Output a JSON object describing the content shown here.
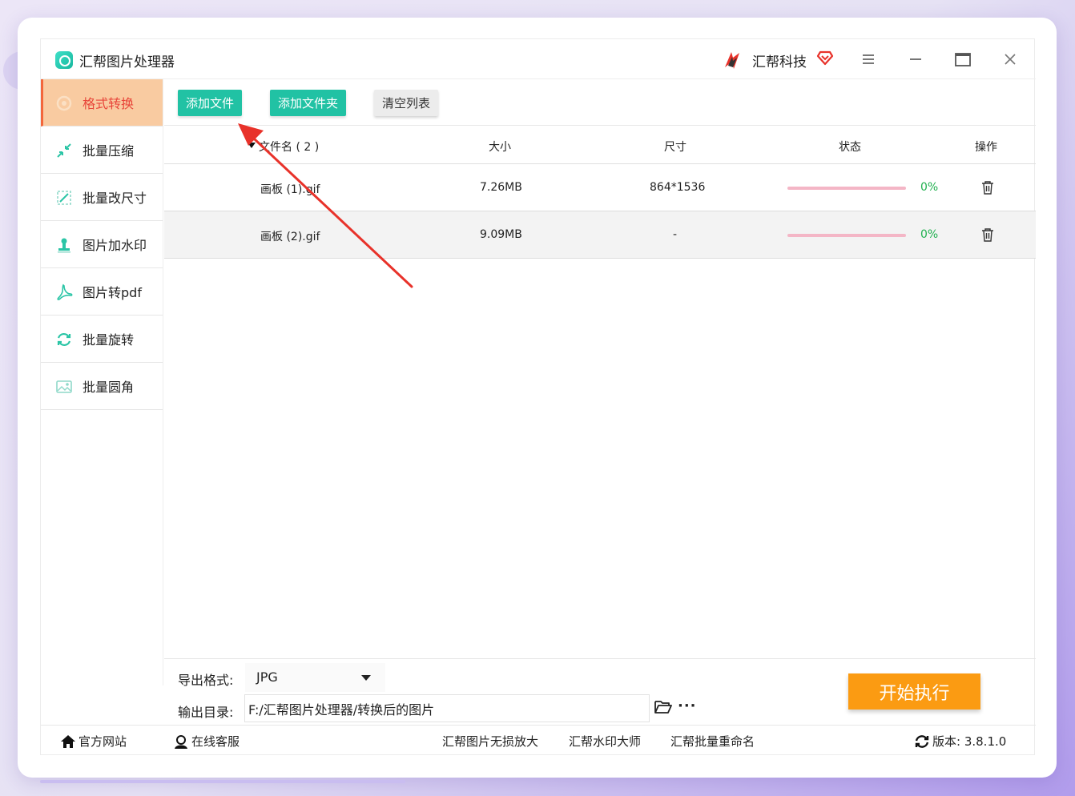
{
  "app": {
    "title": "汇帮图片处理器",
    "brand": "汇帮科技"
  },
  "titlebar_icons": {
    "logo": "app-logo-icon",
    "brand": "flame-logo-icon",
    "vip": "vip-heart-icon",
    "menu": "menu-icon",
    "minimize": "minimize-icon",
    "maximize": "maximize-icon",
    "close": "close-icon"
  },
  "sidebar": {
    "items": [
      {
        "label": "格式转换",
        "icon": "format-convert-icon",
        "active": true
      },
      {
        "label": "批量压缩",
        "icon": "compress-icon",
        "active": false
      },
      {
        "label": "批量改尺寸",
        "icon": "resize-icon",
        "active": false
      },
      {
        "label": "图片加水印",
        "icon": "watermark-icon",
        "active": false
      },
      {
        "label": "图片转pdf",
        "icon": "pdf-icon",
        "active": false
      },
      {
        "label": "批量旋转",
        "icon": "rotate-icon",
        "active": false
      },
      {
        "label": "批量圆角",
        "icon": "rounded-corner-icon",
        "active": false
      }
    ]
  },
  "toolbar": {
    "add_file": "添加文件",
    "add_folder": "添加文件夹",
    "clear_list": "清空列表"
  },
  "table": {
    "headers": {
      "name": "文件名 ( 2 )",
      "size": "大小",
      "dimensions": "尺寸",
      "status": "状态",
      "action": "操作"
    },
    "rows": [
      {
        "name": "画板 (1).gif",
        "size": "7.26MB",
        "dimensions": "864*1536",
        "percent": "0%",
        "progress": 0
      },
      {
        "name": "画板 (2).gif",
        "size": "9.09MB",
        "dimensions": "-",
        "percent": "0%",
        "progress": 0
      }
    ]
  },
  "output": {
    "format_label": "导出格式:",
    "format_value": "JPG",
    "dir_label": "输出目录:",
    "dir_value": "F:/汇帮图片处理器/转换后的图片",
    "more": "···",
    "start": "开始执行"
  },
  "footer": {
    "website": "官方网站",
    "support": "在线客服",
    "link1": "汇帮图片无损放大",
    "link2": "汇帮水印大师",
    "link3": "汇帮批量重命名",
    "version": "版本: 3.8.1.0"
  },
  "colors": {
    "accent": "#21c2a4",
    "start": "#fb9b12",
    "active_bg": "#f9cba1",
    "active_text": "#e8463a",
    "arrow": "#e8322a"
  }
}
